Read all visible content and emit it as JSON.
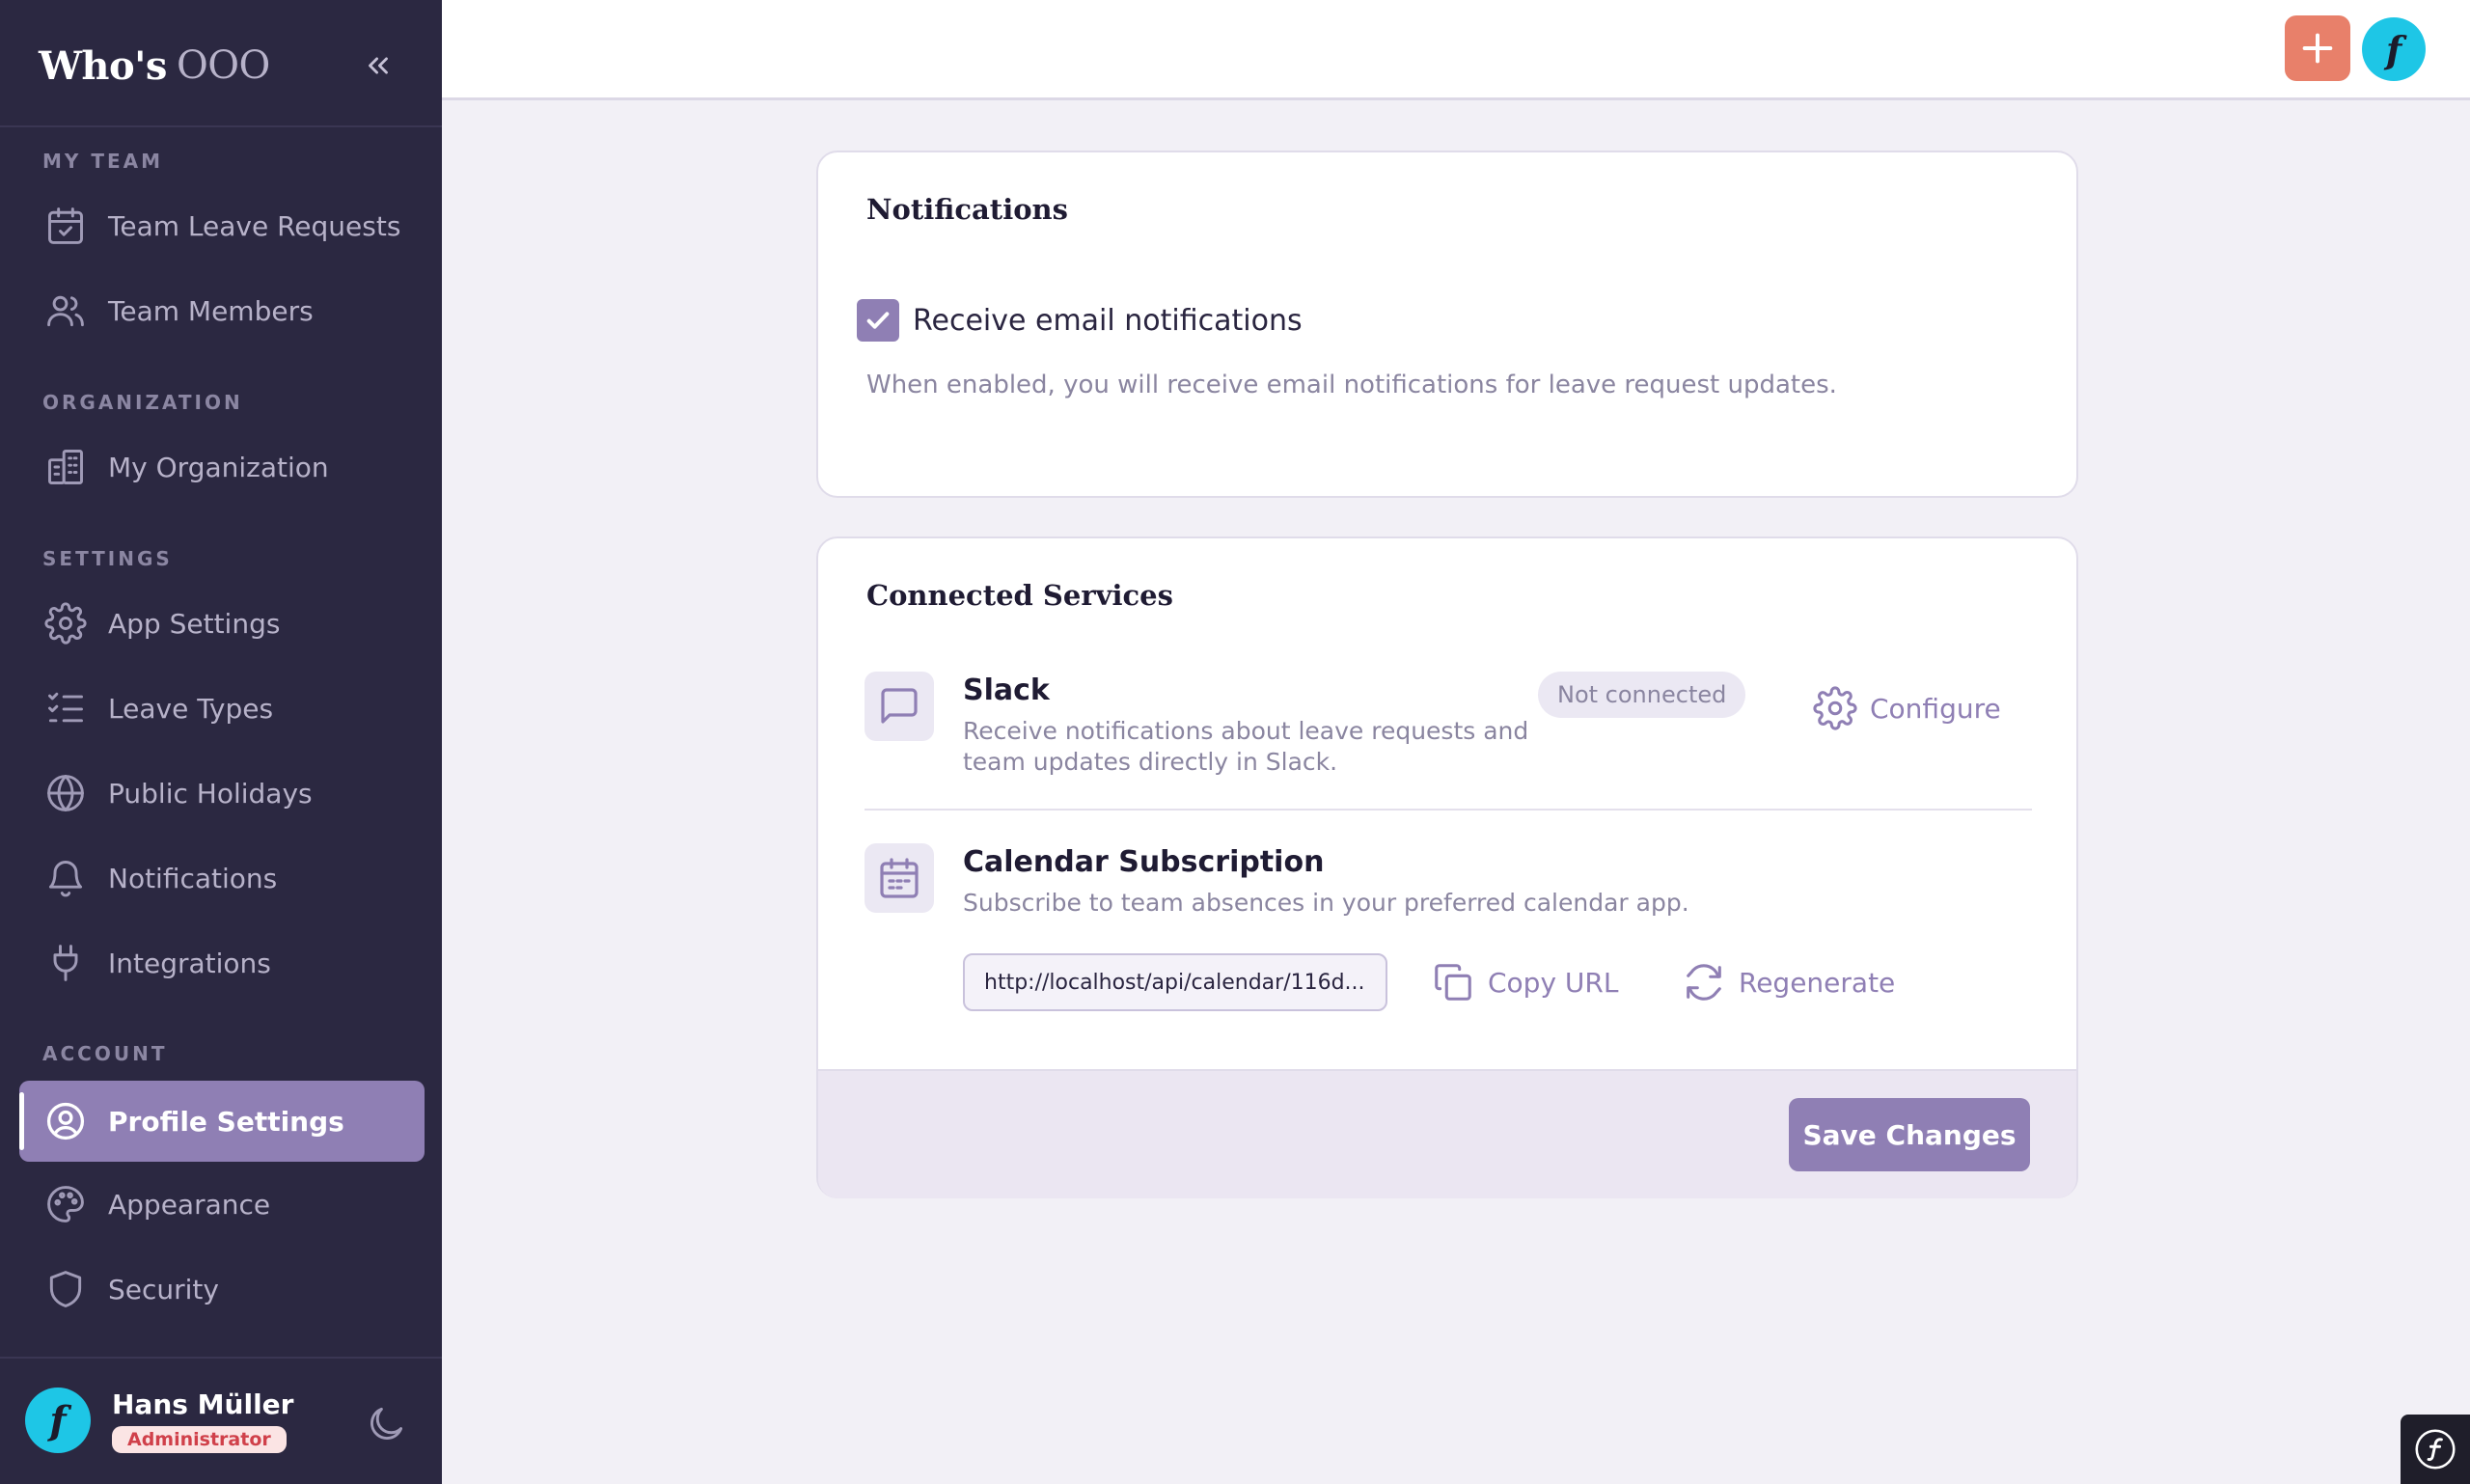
{
  "app": {
    "name_main": "Who's",
    "name_suffix": "OOO"
  },
  "sidebar": {
    "sections": {
      "my_team": "MY TEAM",
      "organization": "ORGANIZATION",
      "settings": "SETTINGS",
      "account": "ACCOUNT"
    },
    "items": [
      {
        "label": "Team Leave Requests",
        "icon": "calendar-check-icon"
      },
      {
        "label": "Team Members",
        "icon": "users-icon"
      },
      {
        "label": "My Organization",
        "icon": "building-icon"
      },
      {
        "label": "App Settings",
        "icon": "gear-icon"
      },
      {
        "label": "Leave Types",
        "icon": "list-checks-icon"
      },
      {
        "label": "Public Holidays",
        "icon": "globe-icon"
      },
      {
        "label": "Notifications",
        "icon": "bell-icon"
      },
      {
        "label": "Integrations",
        "icon": "plug-icon"
      },
      {
        "label": "Profile Settings",
        "icon": "user-circle-icon",
        "active": true
      },
      {
        "label": "Appearance",
        "icon": "palette-icon"
      },
      {
        "label": "Security",
        "icon": "shield-icon"
      }
    ]
  },
  "user": {
    "name": "Hans Müller",
    "role": "Administrator",
    "avatar_glyph": "f"
  },
  "topbar": {
    "avatar_glyph": "f"
  },
  "notifications_card": {
    "title": "Notifications",
    "checkbox_label": "Receive email notifications",
    "checked": true,
    "help": "When enabled, you will receive email notifications for leave request updates."
  },
  "services_card": {
    "title": "Connected Services",
    "slack": {
      "name": "Slack",
      "desc_line1": "Receive notifications about leave requests and",
      "desc_line2": "team updates directly in Slack.",
      "status": "Not connected",
      "configure_label": "Configure"
    },
    "calendar": {
      "name": "Calendar Subscription",
      "desc": "Subscribe to team absences in your preferred calendar app.",
      "url": "http://localhost/api/calendar/116d...",
      "copy_label": "Copy URL",
      "regenerate_label": "Regenerate"
    },
    "save_label": "Save Changes"
  },
  "colors": {
    "sidebar_bg": "#2b2841",
    "accent": "#8f7fb4",
    "add_button": "#e8806a",
    "avatar": "#1ec6e6"
  }
}
